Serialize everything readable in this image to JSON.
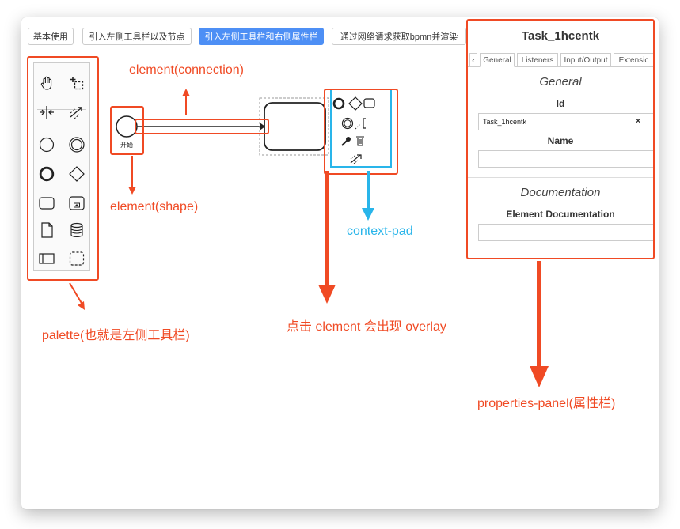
{
  "toolbar": {
    "tabs": [
      {
        "label": "基本使用"
      },
      {
        "label": "引入左侧工具栏以及节点"
      },
      {
        "label": "引入左侧工具栏和右侧属性栏"
      },
      {
        "label": "通过网络请求获取bpmn并渲染"
      }
    ],
    "active_index": 2
  },
  "palette": {
    "tools": [
      "hand-tool-icon",
      "lasso-tool-icon",
      "space-tool-icon",
      "global-connect-icon",
      "start-event-icon",
      "intermediate-event-icon",
      "end-event-icon",
      "gateway-icon",
      "task-icon",
      "subprocess-icon",
      "data-object-icon",
      "data-store-icon",
      "participant-icon",
      "group-icon"
    ]
  },
  "canvas": {
    "start_event_label": "开始"
  },
  "annotations": {
    "connection": "element(connection)",
    "shape": "element(shape)",
    "context_pad": "context-pad",
    "palette": "palette(也就是左侧工具栏)",
    "overlay": "点击 element 会出现 overlay",
    "properties_panel": "properties-panel(属性栏)"
  },
  "properties": {
    "title": "Task_1hcentk",
    "scroll_left": "‹",
    "tabs": [
      {
        "label": "General"
      },
      {
        "label": "Listeners"
      },
      {
        "label": "Input/Output"
      },
      {
        "label": "Extensic"
      }
    ],
    "general_heading": "General",
    "id_label": "Id",
    "id_value": "Task_1hcentk",
    "clear_glyph": "×",
    "name_label": "Name",
    "name_value": "",
    "documentation_heading": "Documentation",
    "element_documentation_label": "Element Documentation",
    "element_documentation_value": ""
  },
  "colors": {
    "annotation_red": "#f04a24",
    "annotation_blue": "#29b5ea",
    "active_tab": "#4d8ff5"
  }
}
